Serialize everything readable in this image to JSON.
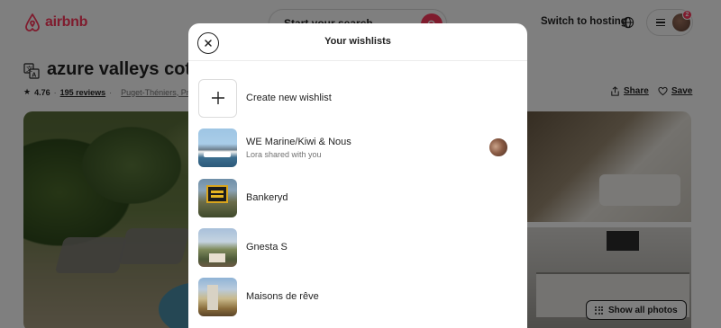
{
  "header": {
    "logo_text": "airbnb",
    "search_placeholder": "Start your search",
    "switch_hosting": "Switch to hosting",
    "notification_count": "2"
  },
  "listing": {
    "title": "azure valleys cottag",
    "rating": "4.76",
    "reviews": "195 reviews",
    "location": "Puget-Théniers, Pro",
    "share_label": "Share",
    "save_label": "Save",
    "show_all_photos": "Show all photos"
  },
  "modal": {
    "title": "Your wishlists",
    "create_label": "Create new wishlist",
    "items": [
      {
        "name": "WE Marine/Kiwi & Nous",
        "subtitle": "Lora shared with you"
      },
      {
        "name": "Bankeryd"
      },
      {
        "name": "Gnesta S"
      },
      {
        "name": "Maisons de rêve"
      }
    ]
  },
  "colors": {
    "brand": "#ff385c",
    "text": "#222222",
    "muted": "#717171"
  },
  "icons": [
    "airbnb-logo-icon",
    "search-icon",
    "globe-icon",
    "menu-icon",
    "translate-icon",
    "star-icon",
    "share-icon",
    "heart-icon",
    "close-icon",
    "plus-icon",
    "grid-dots-icon"
  ]
}
